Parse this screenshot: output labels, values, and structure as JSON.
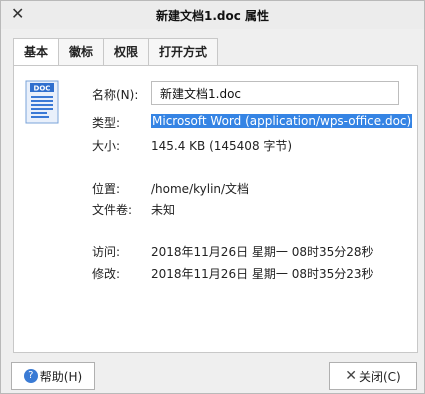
{
  "window": {
    "title": "新建文档1.doc 属性",
    "close_glyph": "✕"
  },
  "tabs": [
    "基本",
    "徽标",
    "权限",
    "打开方式"
  ],
  "file_icon": {
    "badge": "DOC",
    "icon": "doc-file-icon"
  },
  "fields": {
    "name_label": "名称(N):",
    "name_value": "新建文档1.doc",
    "type_label": "类型:",
    "type_value": "Microsoft Word (application/wps-office.doc)",
    "size_label": "大小:",
    "size_value": "145.4 KB (145408 字节)",
    "location_label": "位置:",
    "location_value": "/home/kylin/文档",
    "volume_label": "文件卷:",
    "volume_value": "未知",
    "accessed_label": "访问:",
    "accessed_value": "2018年11月26日 星期一 08时35分28秒",
    "modified_label": "修改:",
    "modified_value": "2018年11月26日 星期一 08时35分23秒"
  },
  "buttons": {
    "help": "帮助(H)",
    "close": "关闭(C)"
  },
  "colors": {
    "selection": "#3584e4"
  }
}
